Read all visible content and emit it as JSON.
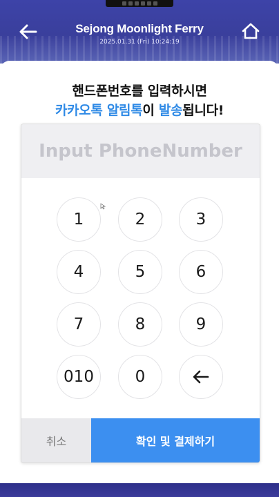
{
  "header": {
    "title": "Sejong Moonlight Ferry",
    "datetime": "2025.01.31 (Fri) 10:24:19"
  },
  "headline": {
    "line1": "핸드폰번호를 입력하시면",
    "line2_blue_a": "카카오톡 알림톡",
    "line2_black_a": "이 ",
    "line2_blue_b": "발송",
    "line2_black_b": "됩니다!"
  },
  "phone_input": {
    "placeholder": "Input PhoneNumber",
    "value": ""
  },
  "keypad": {
    "k1": "1",
    "k2": "2",
    "k3": "3",
    "k4": "4",
    "k5": "5",
    "k6": "6",
    "k7": "7",
    "k8": "8",
    "k9": "9",
    "k010": "010",
    "k0": "0"
  },
  "actions": {
    "cancel_label": "취소",
    "confirm_label": "확인 및 결제하기"
  },
  "colors": {
    "header_bg": "#3d43a8",
    "accent_blue": "#2f8ae6",
    "confirm_bg": "#3c8ff0",
    "cancel_bg": "#e9e9ec"
  },
  "icons": {
    "back": "arrow-left-icon",
    "home": "home-icon",
    "backspace": "arrow-left-icon"
  }
}
